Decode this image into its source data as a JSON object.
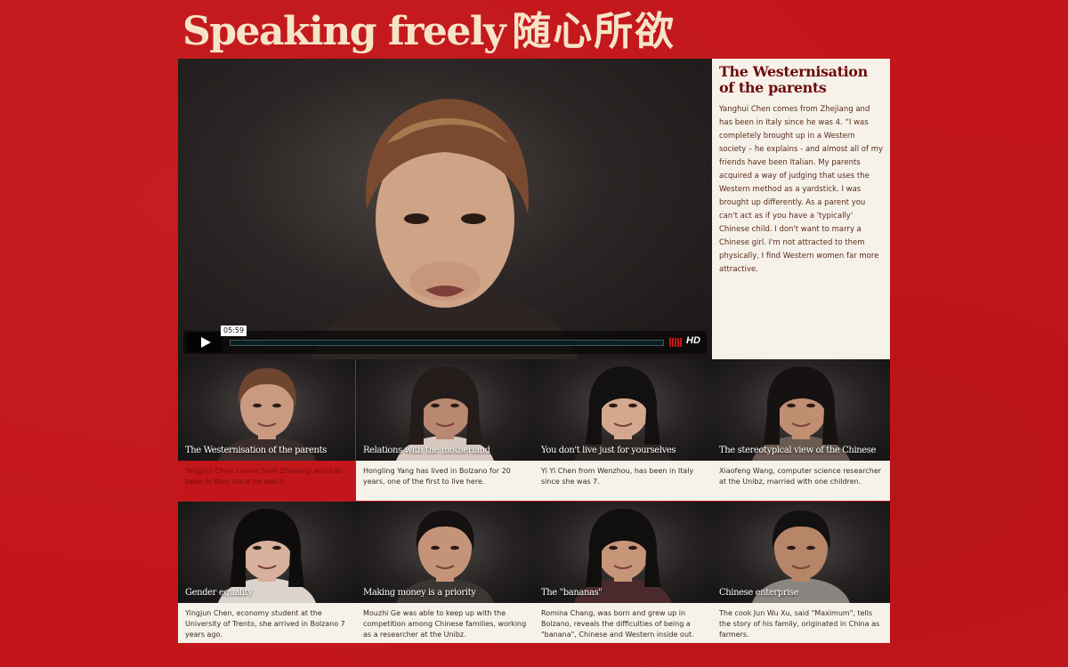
{
  "header": {
    "title_latin": "Speaking freely",
    "title_chinese": "随心所欲"
  },
  "player": {
    "time": "05:59",
    "progress": 0.0,
    "hd_label": "HD",
    "play_icon": "play-icon",
    "volume_icon": "volume-bars-icon"
  },
  "sidebar": {
    "heading": "The Westernisation of the parents",
    "body": "Yanghui Chen comes from Zhejiang and has been in Italy since he was 4. “I was completely brought up in a Western society – he explains - and almost all of my friends have been Italian. My parents acquired a way of judging that uses the Western method as a yardstick. I was brought up differently. As a parent you can't act as if you have a 'typically' Chinese child. I don't want to marry a Chinese girl. I'm not attracted to them physically, I find Western women far more attractive."
  },
  "videos": [
    {
      "caption": "The Westernisation of the parents",
      "description": "Yanghui Chen comes from Zhejiang and has been in Italy since he was 5.",
      "active": true
    },
    {
      "caption": "Relations with the motherland",
      "description": "Hongling Yang has lived in Bolzano for 20 years, one of the first to live here.",
      "active": false
    },
    {
      "caption": "You don't live just for yourselves",
      "description": "Yi Yi Chen from Wenzhou, has been in Italy since she was 7.",
      "active": false
    },
    {
      "caption": "The stereotypical view of the Chinese",
      "description": "Xiaofeng Wang, computer science researcher at the Unibz, married with one children.",
      "active": false
    },
    {
      "caption": "Gender equality",
      "description": "Yingjun Chen, economy student at the University of Trento, she arrived in Bolzano 7 years ago.",
      "active": false
    },
    {
      "caption": "Making money is a priority",
      "description": "Mouzhi Ge was able to keep up with the competition among Chinese families, working as a researcher at the Unibz.",
      "active": false
    },
    {
      "caption": "The \"bananas\"",
      "description": "Romina Chang, was born and grew up in Bolzano, reveals the difficulties of being a \"banana\", Chinese and Western inside out.",
      "active": false
    },
    {
      "caption": "Chinese enterprise",
      "description": "The cook Jun Wu Xu, said \"Maximum\", tells the story of his family, originated in China as farmers.",
      "active": false
    }
  ],
  "colors": {
    "background": "#c3161a",
    "title": "#f6e4c8",
    "panel": "#f6f2ea",
    "heading": "#6e0b0e",
    "progress": "#5d8b8e"
  }
}
